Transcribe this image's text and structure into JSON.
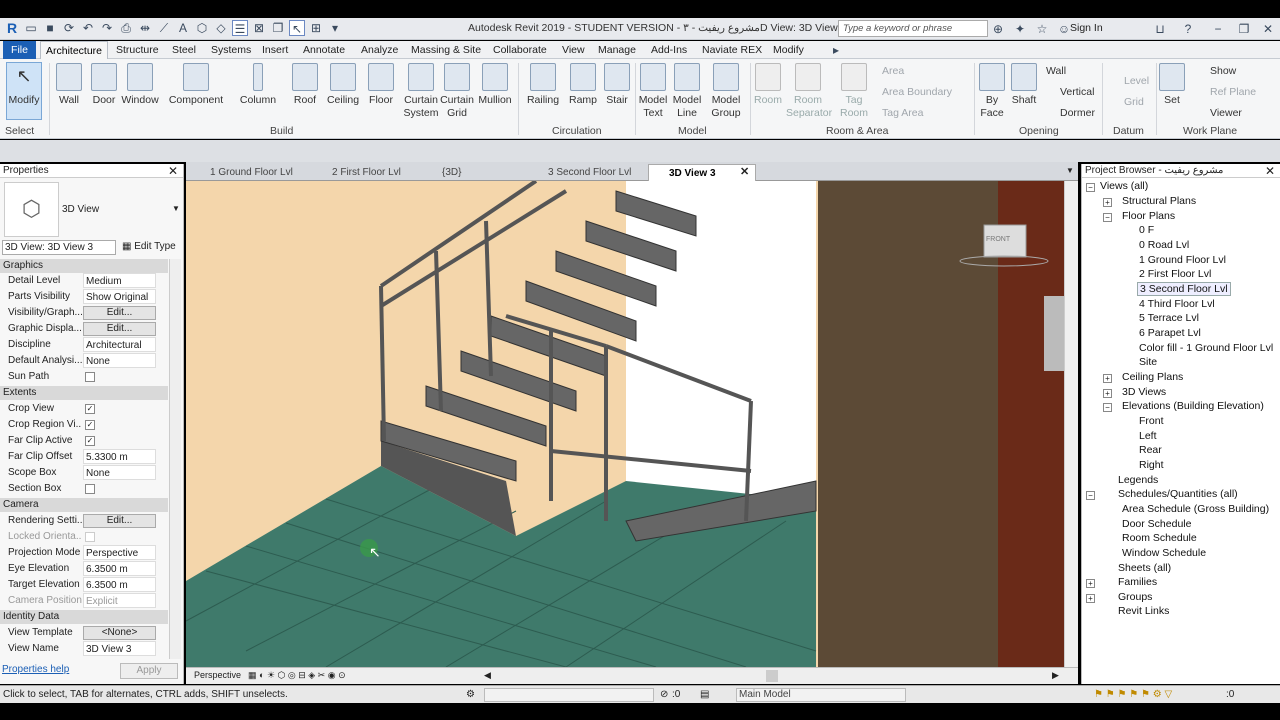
{
  "app": {
    "title": "Autodesk Revit 2019 - STUDENT VERSION - مشروع ريفيت - ۳D View: 3D View 3",
    "search_placeholder": "Type a keyword or phrase",
    "sign_in": "Sign In"
  },
  "tabs": [
    "File",
    "Architecture",
    "Structure",
    "Steel",
    "Systems",
    "Insert",
    "Annotate",
    "Analyze",
    "Massing & Site",
    "Collaborate",
    "View",
    "Manage",
    "Add-Ins",
    "Naviate REX",
    "Modify"
  ],
  "ribbon": {
    "select": {
      "modify": "Modify",
      "label": "Select"
    },
    "build": {
      "label": "Build",
      "items": [
        "Wall",
        "Door",
        "Window",
        "Component",
        "Column",
        "Roof",
        "Ceiling",
        "Floor",
        "Curtain System",
        "Curtain Grid",
        "Mullion"
      ]
    },
    "circulation": {
      "label": "Circulation",
      "items": [
        "Railing",
        "Ramp",
        "Stair"
      ]
    },
    "model": {
      "label": "Model",
      "items": [
        "Model Text",
        "Model Line",
        "Model Group"
      ]
    },
    "room_area": {
      "label": "Room & Area",
      "items": [
        "Room",
        "Room Separator",
        "Tag Room"
      ],
      "small": [
        "Area",
        "Area Boundary",
        "Tag Area"
      ]
    },
    "opening": {
      "label": "Opening",
      "items": [
        "By Face",
        "Shaft"
      ],
      "small": [
        "Wall",
        "Vertical",
        "Dormer"
      ]
    },
    "datum": {
      "label": "Datum",
      "small": [
        "Level",
        "Grid"
      ]
    },
    "work_plane": {
      "label": "Work Plane",
      "items": [
        "Set"
      ],
      "small": [
        "Show",
        "Ref Plane",
        "Viewer"
      ]
    }
  },
  "properties": {
    "title": "Properties",
    "type_name": "3D View",
    "instance": "3D View: 3D View 3",
    "edit_type": "Edit Type",
    "help": "Properties help",
    "apply": "Apply",
    "sections": {
      "graphics": "Graphics",
      "extents": "Extents",
      "camera": "Camera",
      "identity": "Identity Data"
    },
    "rows": {
      "detail_level": [
        "Detail Level",
        "Medium"
      ],
      "parts_visibility": [
        "Parts Visibility",
        "Show Original"
      ],
      "vg": [
        "Visibility/Graph...",
        "Edit..."
      ],
      "gdo": [
        "Graphic Displa...",
        "Edit..."
      ],
      "discipline": [
        "Discipline",
        "Architectural"
      ],
      "default_analysis": [
        "Default Analysi...",
        "None"
      ],
      "sun_path": [
        "Sun Path",
        ""
      ],
      "crop_view": [
        "Crop View",
        "✓"
      ],
      "crop_region": [
        "Crop Region Vi...",
        "✓"
      ],
      "far_clip_active": [
        "Far Clip Active",
        "✓"
      ],
      "far_clip_offset": [
        "Far Clip Offset",
        "5.3300 m"
      ],
      "scope_box": [
        "Scope Box",
        "None"
      ],
      "section_box": [
        "Section Box",
        ""
      ],
      "rendering": [
        "Rendering Setti...",
        "Edit..."
      ],
      "locked": [
        "Locked Orienta...",
        ""
      ],
      "projection": [
        "Projection Mode",
        "Perspective"
      ],
      "eye_elev": [
        "Eye Elevation",
        "6.3500 m"
      ],
      "target_elev": [
        "Target Elevation",
        "6.3500 m"
      ],
      "camera_pos": [
        "Camera Position",
        "Explicit"
      ],
      "view_template": [
        "View Template",
        "<None>"
      ],
      "view_name": [
        "View Name",
        "3D View 3"
      ]
    }
  },
  "view_tabs": [
    "1 Ground Floor Lvl",
    "2 First Floor Lvl",
    "{3D}",
    "3 Second Floor Lvl",
    "3D View 3"
  ],
  "viewport": {
    "cube_label": "FRONT",
    "view_bar": "Perspective"
  },
  "browser": {
    "title": "Project Browser - مشروع ريفيت",
    "items": [
      "Views (all)",
      "Structural Plans",
      "Floor Plans",
      "0 F",
      "0 Road Lvl",
      "1 Ground Floor Lvl",
      "2 First Floor Lvl",
      "3 Second Floor Lvl",
      "4 Third Floor Lvl",
      "5 Terrace Lvl",
      "6 Parapet Lvl",
      "Color fill - 1 Ground Floor Lvl",
      "Site",
      "Ceiling Plans",
      "3D Views",
      "Elevations (Building Elevation)",
      "Front",
      "Left",
      "Rear",
      "Right",
      "Legends",
      "Schedules/Quantities (all)",
      "Area Schedule (Gross Building)",
      "Door Schedule",
      "Room Schedule",
      "Window Schedule",
      "Sheets (all)",
      "Families",
      "Groups",
      "Revit Links"
    ]
  },
  "status": {
    "message": "Click to select, TAB for alternates, CTRL adds, SHIFT unselects.",
    "zero": ":0",
    "model": "Main Model",
    "filter": ":0"
  }
}
